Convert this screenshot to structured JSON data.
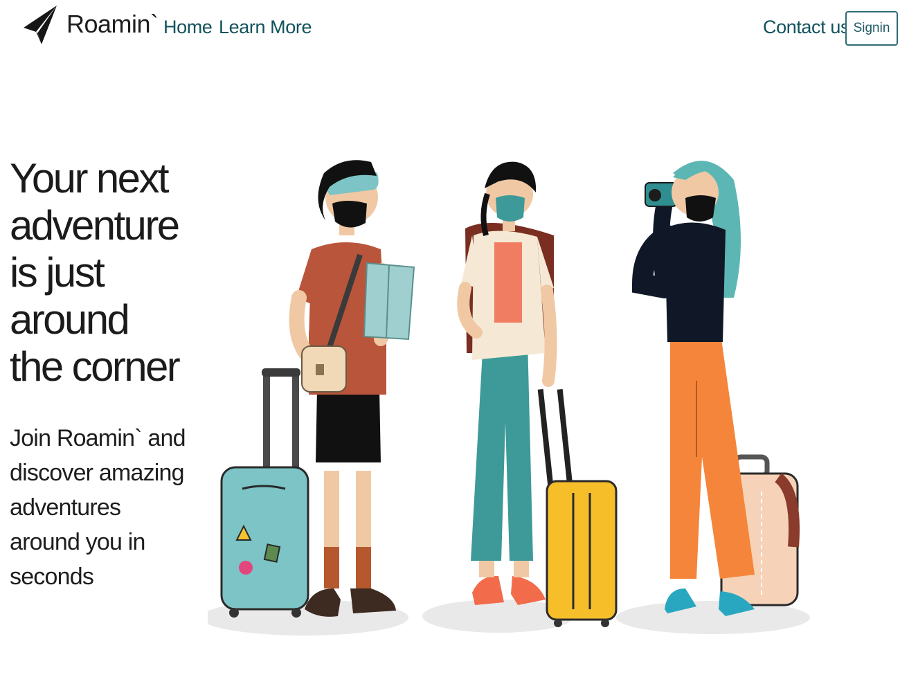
{
  "nav": {
    "logo_icon": "paper-plane-icon",
    "brand": "Roamin`",
    "links": [
      "Home",
      "Learn More"
    ],
    "contact": "Contact us",
    "signin": "Signin"
  },
  "hero": {
    "title": "Your next adventure is just around the corner",
    "subtitle": "Join Roamin` and discover amazing adventures around you in seconds"
  },
  "colors": {
    "nav_link": "#12525c",
    "button_border": "#2f6b75",
    "teal_suitcase": "#7cc4c6",
    "yellow_suitcase": "#f6bf2a",
    "orange_pants": "#f5853a"
  },
  "illustration": {
    "subject": "three-travelers-with-suitcases"
  }
}
